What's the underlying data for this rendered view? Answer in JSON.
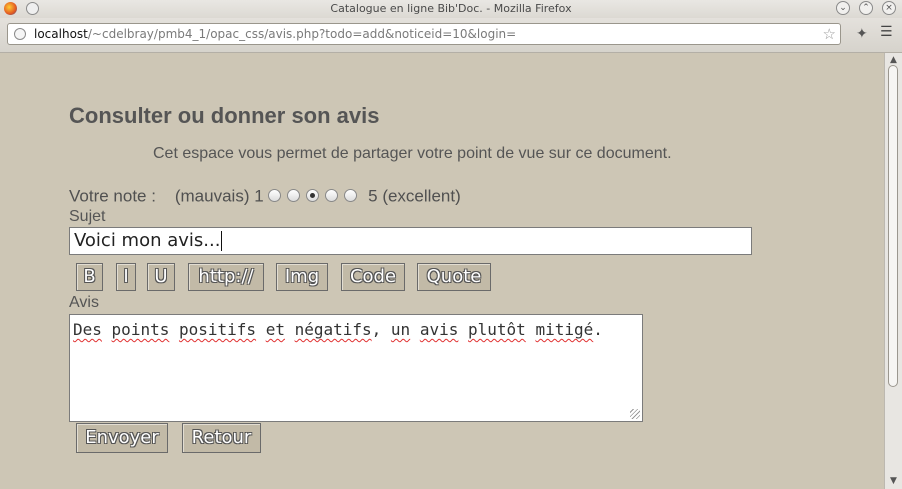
{
  "window": {
    "title": "Catalogue en ligne Bib'Doc. - Mozilla Firefox"
  },
  "navigation": {
    "url_host": "localhost",
    "url_path": "/~cdelbray/pmb4_1/opac_css/avis.php?todo=add&noticeid=10&login="
  },
  "page": {
    "title": "Consulter ou donner son avis",
    "intro": "Cet espace vous permet de partager votre point de vue sur ce document."
  },
  "rating": {
    "label": "Votre note :",
    "min_label": "(mauvais) 1",
    "max_label": "5 (excellent)",
    "selected": 3,
    "count": 5
  },
  "subject": {
    "label": "Sujet",
    "value": "Voici mon avis..."
  },
  "toolbar": {
    "bold": "B",
    "italic": "I",
    "underline": "U",
    "link": "http://",
    "image": "Img",
    "code": "Code",
    "quote": "Quote"
  },
  "review": {
    "label": "Avis",
    "words": [
      "Des",
      " ",
      "points",
      " ",
      "positifs",
      " ",
      "et",
      " ",
      "négatifs",
      ", ",
      "un",
      " ",
      "avis",
      " ",
      "plutôt",
      " ",
      "mitigé",
      "."
    ]
  },
  "actions": {
    "submit": "Envoyer",
    "back": "Retour"
  },
  "icons": {
    "app": "firefox-icon",
    "url": "globe-icon",
    "bookmark": "star-icon"
  }
}
